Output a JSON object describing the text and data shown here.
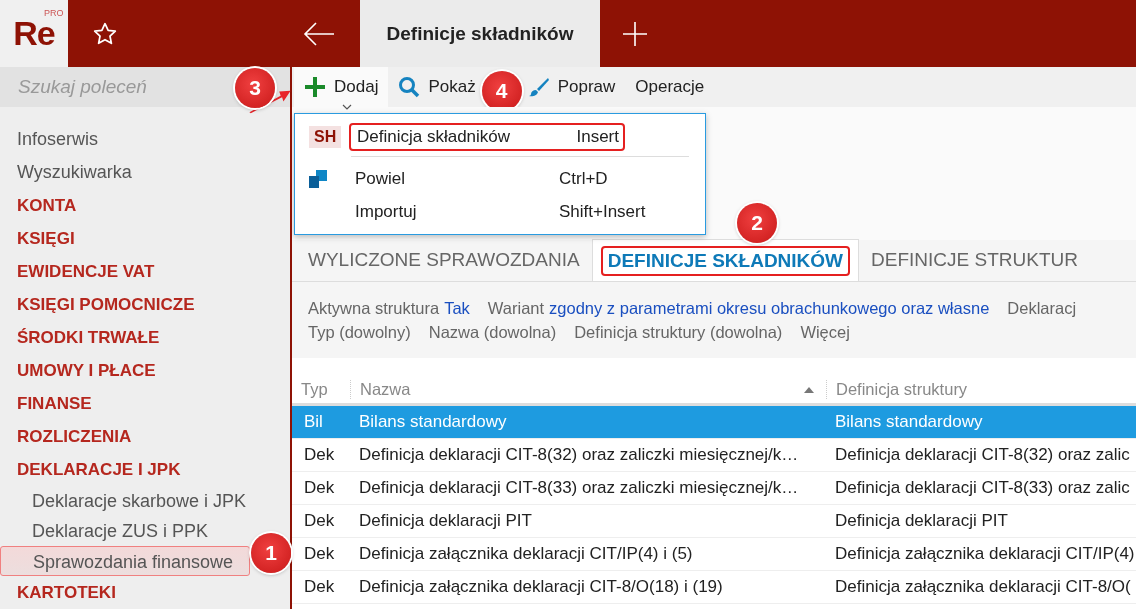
{
  "app": {
    "logo": "Re",
    "logo_badge": "PRO"
  },
  "open_tab": {
    "label": "Definicje składników",
    "selected": true
  },
  "search": {
    "placeholder": "Szukaj poleceń"
  },
  "sidebar": {
    "items": [
      {
        "label": "Infoserwis",
        "kind": "link",
        "selected": false
      },
      {
        "label": "Wyszukiwarka",
        "kind": "link",
        "selected": false
      },
      {
        "label": "KONTA",
        "kind": "section",
        "selected": false
      },
      {
        "label": "KSIĘGI",
        "kind": "section",
        "selected": false
      },
      {
        "label": "EWIDENCJE VAT",
        "kind": "section",
        "selected": false
      },
      {
        "label": "KSIĘGI POMOCNICZE",
        "kind": "section",
        "selected": false
      },
      {
        "label": "ŚRODKI TRWAŁE",
        "kind": "section",
        "selected": false
      },
      {
        "label": "UMOWY I PŁACE",
        "kind": "section",
        "selected": false
      },
      {
        "label": "FINANSE",
        "kind": "section",
        "selected": false
      },
      {
        "label": "ROZLICZENIA",
        "kind": "section",
        "selected": false
      },
      {
        "label": "DEKLARACJE I JPK",
        "kind": "section",
        "selected": false
      },
      {
        "label": "Deklaracje skarbowe i JPK",
        "kind": "subitem",
        "selected": false
      },
      {
        "label": "Deklaracje ZUS i PPK",
        "kind": "subitem",
        "selected": false
      },
      {
        "label": "Sprawozdania finansowe",
        "kind": "subitem",
        "selected": true,
        "highlighted": true
      },
      {
        "label": "KARTOTEKI",
        "kind": "section",
        "selected": false
      }
    ]
  },
  "toolbar": [
    {
      "label": "Dodaj",
      "kind": "add",
      "expanded": true
    },
    {
      "label": "Pokaż",
      "kind": "view",
      "expanded": false
    },
    {
      "label": "Popraw",
      "kind": "edit",
      "expanded": false
    },
    {
      "label": "Operacje",
      "kind": "plain",
      "expanded": false
    }
  ],
  "dropdown": [
    {
      "label": "Definicja składników",
      "shortcut": "Insert",
      "kind": "badge",
      "badge": "SH",
      "highlighted": true
    },
    {
      "label": "Powiel",
      "shortcut": "Ctrl+D",
      "kind": "copy",
      "highlighted": false
    },
    {
      "label": "Importuj",
      "shortcut": "Shift+Insert",
      "kind": "plain",
      "highlighted": false
    }
  ],
  "tabs": [
    {
      "label": "WYLICZONE SPRAWOZDANIA",
      "selected": false,
      "highlighted": false
    },
    {
      "label": "DEFINICJE SKŁADNIKÓW",
      "selected": true,
      "highlighted": true
    },
    {
      "label": "DEFINICJE STRUKTUR",
      "selected": false,
      "highlighted": false
    }
  ],
  "filters": [
    [
      {
        "label": "Aktywna struktura",
        "value": "Tak"
      },
      {
        "label": "Wariant",
        "value": "zgodny z parametrami okresu obrachunkowego oraz własne"
      },
      {
        "label": "Deklaracj"
      }
    ],
    [
      {
        "label": "Typ (dowolny)"
      },
      {
        "label": "Nazwa (dowolna)"
      },
      {
        "label": "Definicja struktury (dowolna)"
      },
      {
        "label": "Więcej"
      }
    ]
  ],
  "table": {
    "columns": [
      {
        "label": "Typ",
        "sorted": false
      },
      {
        "label": "Nazwa",
        "sorted": true
      },
      {
        "label": "Definicja struktury",
        "sorted": false
      }
    ],
    "rows": [
      {
        "cells": [
          "Bil",
          "Bilans standardowy",
          "Bilans standardowy"
        ],
        "selected": true
      },
      {
        "cells": [
          "Dek",
          "Definicja deklaracji CIT-8(32) oraz zaliczki miesięcznej/k…",
          "Definicja deklaracji CIT-8(32) oraz zalic"
        ],
        "selected": false
      },
      {
        "cells": [
          "Dek",
          "Definicja deklaracji CIT-8(33) oraz zaliczki miesięcznej/k…",
          "Definicja deklaracji CIT-8(33) oraz zalic"
        ],
        "selected": false
      },
      {
        "cells": [
          "Dek",
          "Definicja deklaracji PIT",
          "Definicja deklaracji PIT"
        ],
        "selected": false
      },
      {
        "cells": [
          "Dek",
          "Definicja załącznika deklaracji CIT/IP(4) i (5)",
          "Definicja załącznika deklaracji CIT/IP(4)"
        ],
        "selected": false
      },
      {
        "cells": [
          "Dek",
          "Definicja załącznika deklaracji CIT-8/O(18) i (19)",
          "Definicja załącznika deklaracji CIT-8/O("
        ],
        "selected": false
      }
    ]
  },
  "annotations": [
    {
      "label": "1"
    },
    {
      "label": "2"
    },
    {
      "label": "3"
    },
    {
      "label": "4"
    }
  ]
}
